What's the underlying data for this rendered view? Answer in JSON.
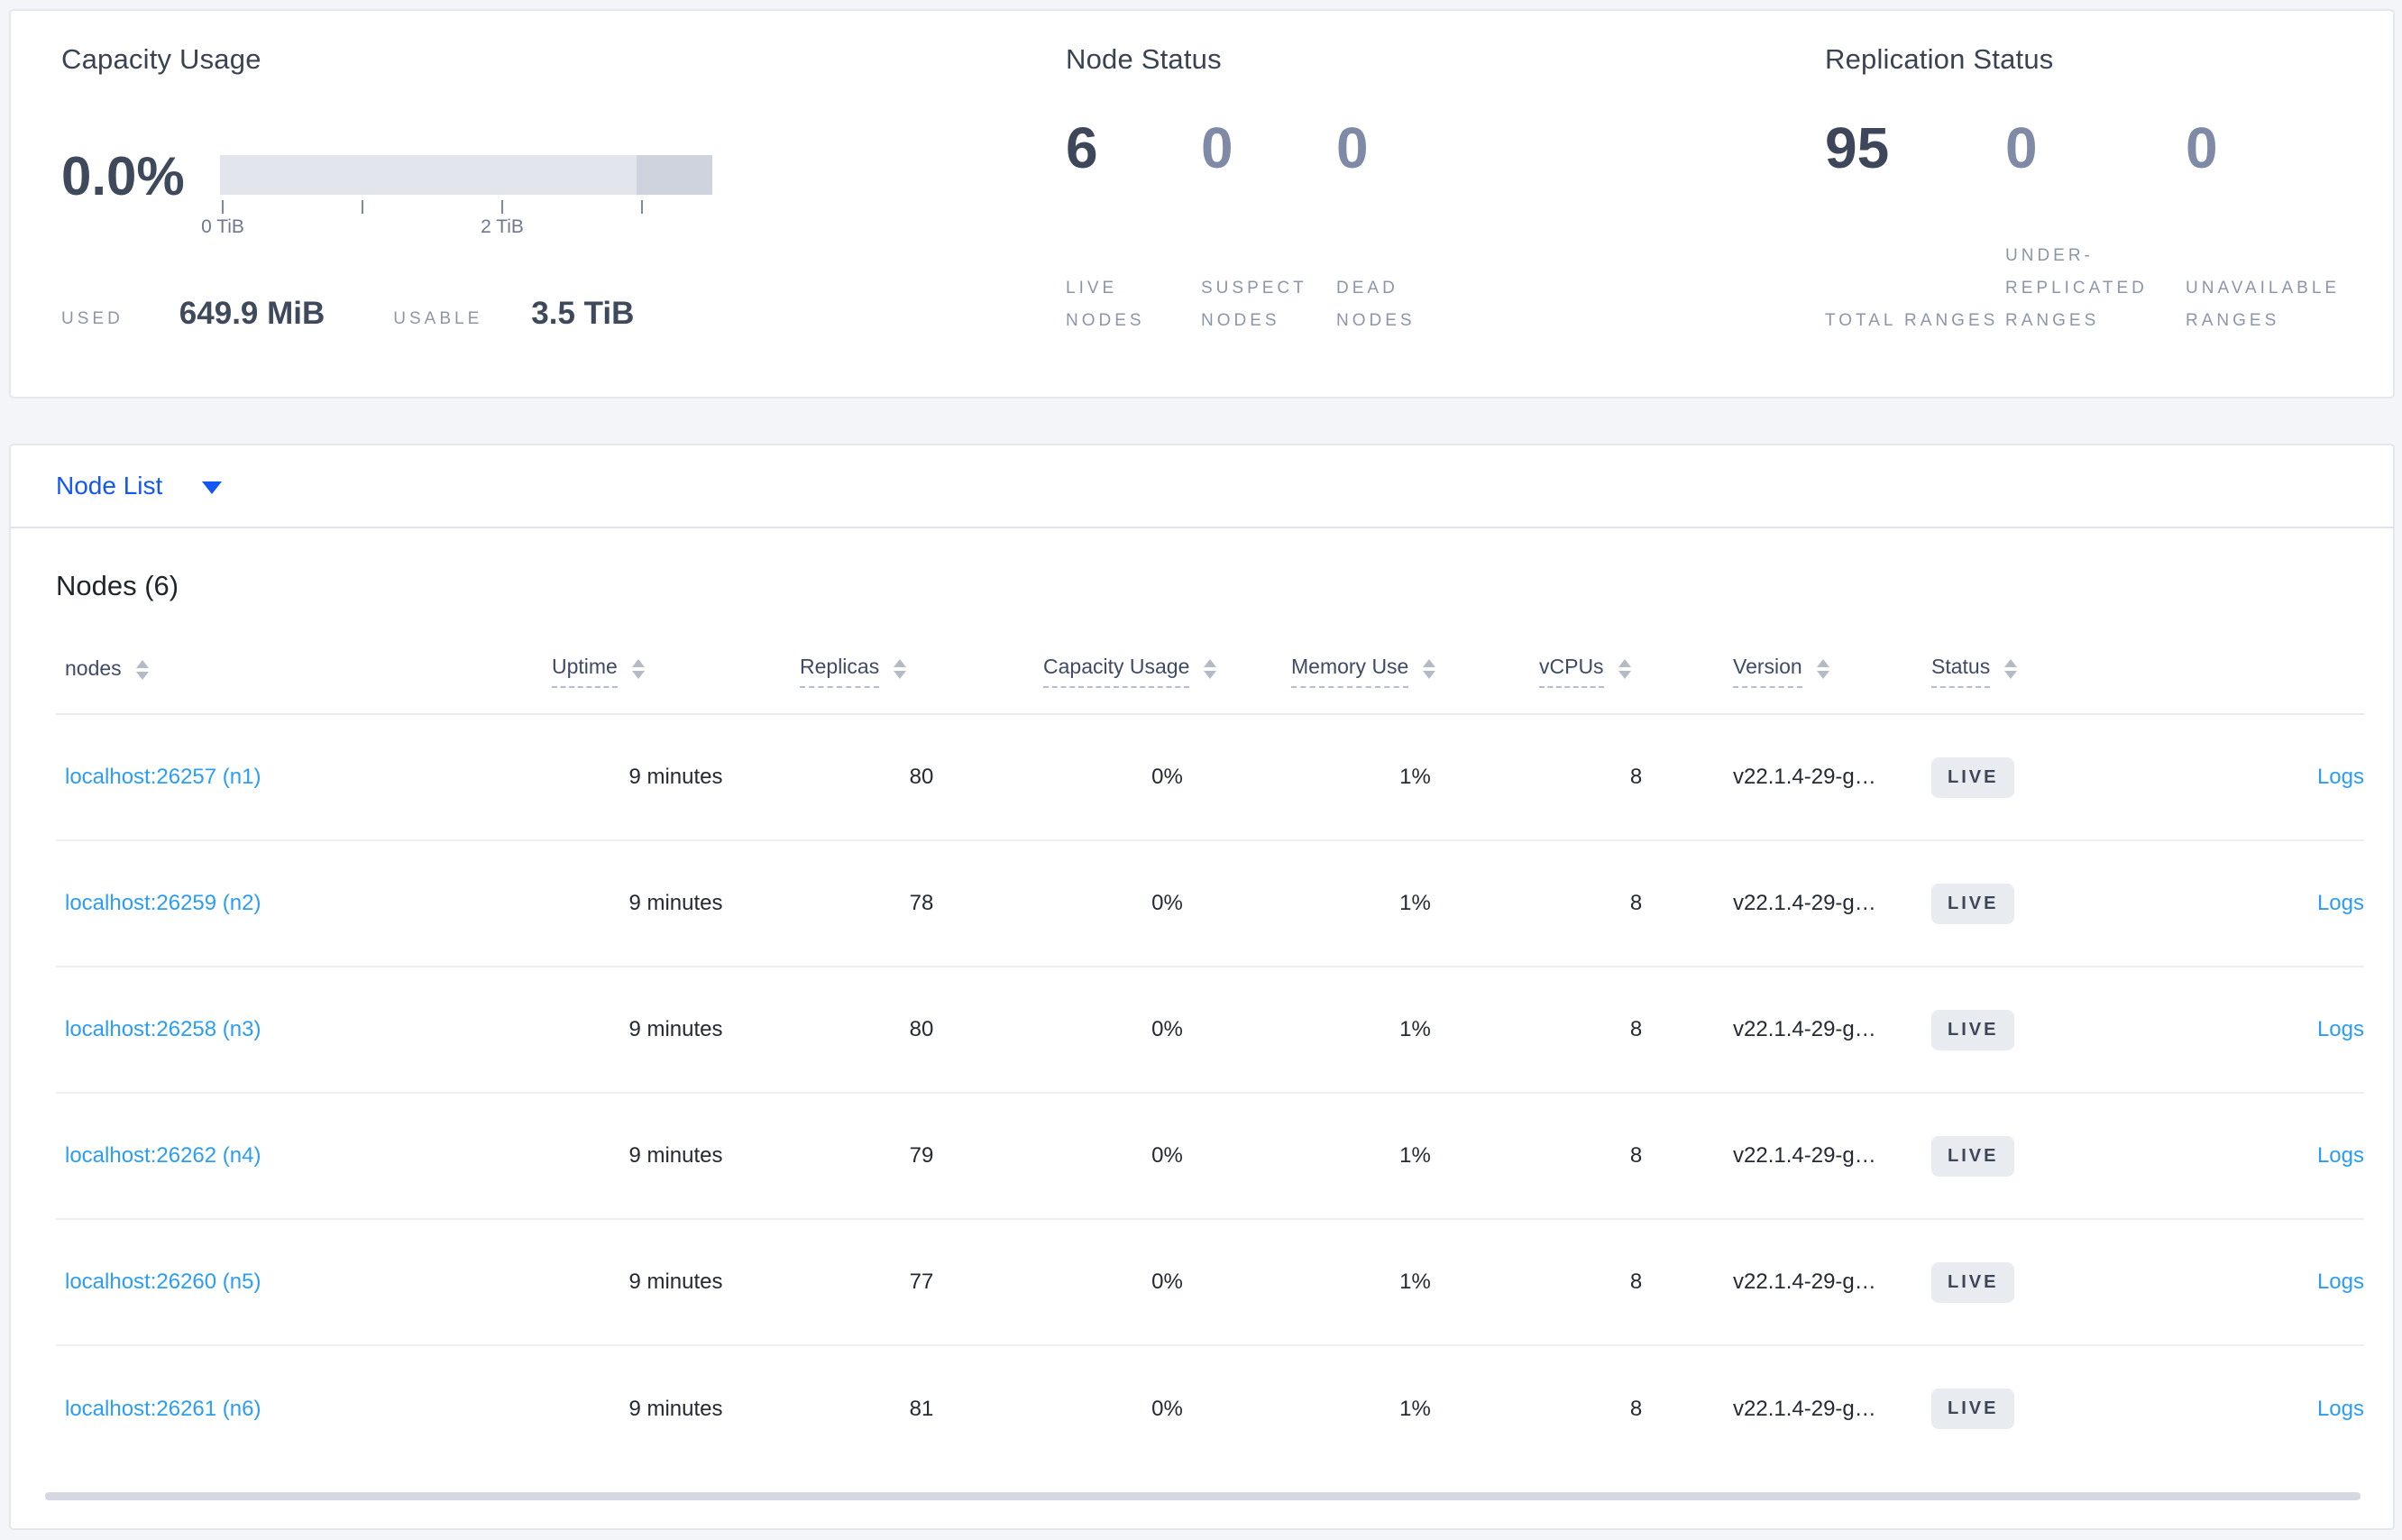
{
  "summary": {
    "capacity": {
      "title": "Capacity Usage",
      "percent": "0.0%",
      "tick_labels": [
        "0 TiB",
        "2 TiB"
      ],
      "used_label": "USED",
      "used_value": "649.9 MiB",
      "usable_label": "USABLE",
      "usable_value": "3.5 TiB"
    },
    "node_status": {
      "title": "Node Status",
      "stats": [
        {
          "value": "6",
          "label": "LIVE NODES"
        },
        {
          "value": "0",
          "label": "SUSPECT NODES"
        },
        {
          "value": "0",
          "label": "DEAD NODES"
        }
      ]
    },
    "replication": {
      "title": "Replication Status",
      "stats": [
        {
          "value": "95",
          "label": "TOTAL RANGES"
        },
        {
          "value": "0",
          "label": "UNDER-REPLICATED RANGES"
        },
        {
          "value": "0",
          "label": "UNAVAILABLE RANGES"
        }
      ]
    }
  },
  "view_selector": {
    "label": "Node List"
  },
  "nodes_table": {
    "title": "Nodes (6)",
    "columns": {
      "nodes": "nodes",
      "uptime": "Uptime",
      "replicas": "Replicas",
      "capacity": "Capacity Usage",
      "memory": "Memory Use",
      "vcpus": "vCPUs",
      "version": "Version",
      "status": "Status"
    },
    "rows": [
      {
        "address": "localhost:26257 (n1)",
        "uptime": "9 minutes",
        "replicas": "80",
        "capacity": "0%",
        "memory": "1%",
        "vcpus": "8",
        "version": "v22.1.4-29-g…",
        "status": "LIVE",
        "logs": "Logs"
      },
      {
        "address": "localhost:26259 (n2)",
        "uptime": "9 minutes",
        "replicas": "78",
        "capacity": "0%",
        "memory": "1%",
        "vcpus": "8",
        "version": "v22.1.4-29-g…",
        "status": "LIVE",
        "logs": "Logs"
      },
      {
        "address": "localhost:26258 (n3)",
        "uptime": "9 minutes",
        "replicas": "80",
        "capacity": "0%",
        "memory": "1%",
        "vcpus": "8",
        "version": "v22.1.4-29-g…",
        "status": "LIVE",
        "logs": "Logs"
      },
      {
        "address": "localhost:26262 (n4)",
        "uptime": "9 minutes",
        "replicas": "79",
        "capacity": "0%",
        "memory": "1%",
        "vcpus": "8",
        "version": "v22.1.4-29-g…",
        "status": "LIVE",
        "logs": "Logs"
      },
      {
        "address": "localhost:26260 (n5)",
        "uptime": "9 minutes",
        "replicas": "77",
        "capacity": "0%",
        "memory": "1%",
        "vcpus": "8",
        "version": "v22.1.4-29-g…",
        "status": "LIVE",
        "logs": "Logs"
      },
      {
        "address": "localhost:26261 (n6)",
        "uptime": "9 minutes",
        "replicas": "81",
        "capacity": "0%",
        "memory": "1%",
        "vcpus": "8",
        "version": "v22.1.4-29-g…",
        "status": "LIVE",
        "logs": "Logs"
      }
    ]
  }
}
